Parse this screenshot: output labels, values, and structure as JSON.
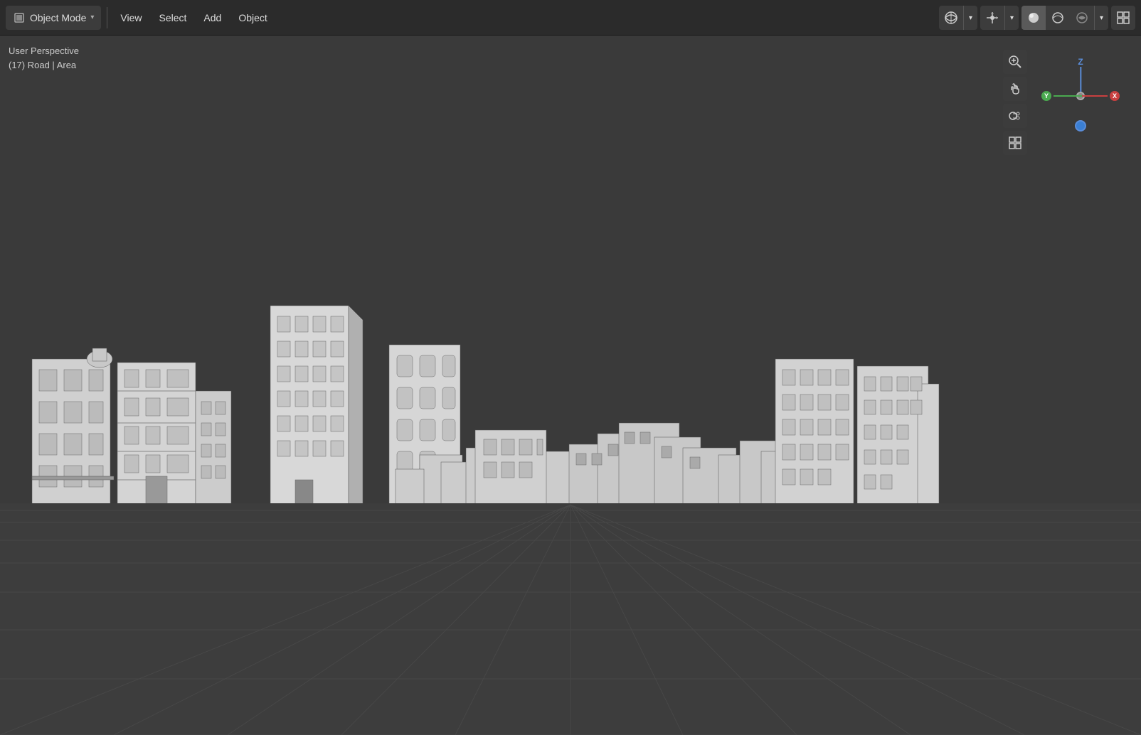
{
  "toolbar": {
    "mode_label": "Object Mode",
    "mode_dropdown": "▾",
    "view_label": "View",
    "select_label": "Select",
    "add_label": "Add",
    "object_label": "Object"
  },
  "viewport": {
    "perspective_label": "User Perspective",
    "scene_label": "(17) Road | Area"
  },
  "right_toolbar": {
    "viewport_shading_options": [
      "Material Preview",
      "Solid",
      "Wireframe",
      "Rendered"
    ],
    "active_shading": "Solid"
  },
  "gizmo": {
    "z_label": "Z",
    "x_label": "X",
    "y_label": "Y"
  },
  "icons": {
    "object_mode": "⬛",
    "view": "👁",
    "cursor": "⊕",
    "move": "✋",
    "camera": "🎥",
    "grid": "⊞",
    "zoom": "🔍",
    "dropdown": "▾"
  }
}
